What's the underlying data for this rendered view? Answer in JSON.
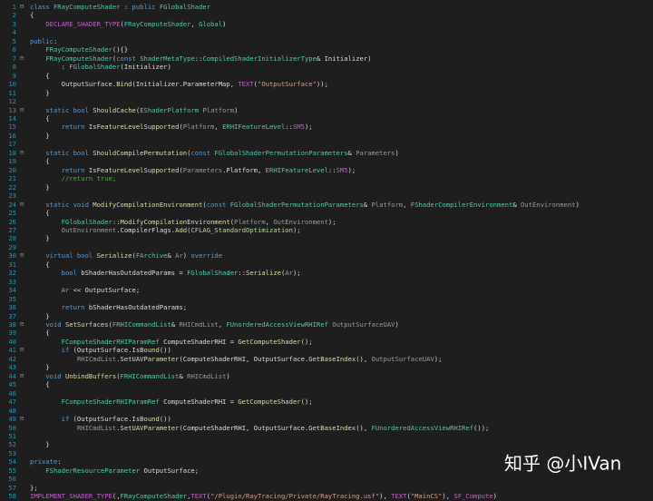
{
  "editor": {
    "lines": [
      {
        "n": "1",
        "fold": "⊟",
        "seg": [
          [
            "k",
            "class "
          ],
          [
            "ty",
            "FRayComputeShader"
          ],
          [
            "x",
            " : "
          ],
          [
            "k",
            "public "
          ],
          [
            "ty",
            "FGlobalShader"
          ]
        ]
      },
      {
        "n": "2",
        "seg": [
          [
            "x",
            "{"
          ]
        ]
      },
      {
        "n": "3",
        "seg": [
          [
            "x",
            "    "
          ],
          [
            "m",
            "DECLARE_SHADER_TYPE"
          ],
          [
            "x",
            "("
          ],
          [
            "ty",
            "FRayComputeShader"
          ],
          [
            "x",
            ", "
          ],
          [
            "ty",
            "Global"
          ],
          [
            "x",
            ")"
          ]
        ]
      },
      {
        "n": "4",
        "seg": []
      },
      {
        "n": "5",
        "seg": [
          [
            "k",
            "public"
          ],
          [
            "x",
            ":"
          ]
        ]
      },
      {
        "n": "6",
        "seg": [
          [
            "x",
            "    "
          ],
          [
            "ty",
            "FRayComputeShader"
          ],
          [
            "x",
            "(){}"
          ]
        ]
      },
      {
        "n": "7",
        "fold": "⊟",
        "seg": [
          [
            "x",
            "    "
          ],
          [
            "ty",
            "FRayComputeShader"
          ],
          [
            "x",
            "("
          ],
          [
            "k",
            "const "
          ],
          [
            "ty",
            "ShaderMetaType"
          ],
          [
            "x",
            "::"
          ],
          [
            "ty",
            "CompiledShaderInitializerType"
          ],
          [
            "x",
            "& Initializer)"
          ]
        ]
      },
      {
        "n": "8",
        "seg": [
          [
            "x",
            "        : "
          ],
          [
            "ty",
            "FGlobalShader"
          ],
          [
            "x",
            "(Initializer)"
          ]
        ]
      },
      {
        "n": "9",
        "seg": [
          [
            "x",
            "    {"
          ]
        ]
      },
      {
        "n": "10",
        "seg": [
          [
            "x",
            "        OutputSurface."
          ],
          [
            "f",
            "Bind"
          ],
          [
            "x",
            "(Initializer.ParameterMap, "
          ],
          [
            "m",
            "TEXT"
          ],
          [
            "x",
            "("
          ],
          [
            "s",
            "\"OutputSurface\""
          ],
          [
            "x",
            "));"
          ]
        ]
      },
      {
        "n": "11",
        "seg": [
          [
            "x",
            "    }"
          ]
        ]
      },
      {
        "n": "12",
        "seg": []
      },
      {
        "n": "13",
        "fold": "⊟",
        "seg": [
          [
            "x",
            "    "
          ],
          [
            "k",
            "static bool "
          ],
          [
            "f",
            "ShouldCache"
          ],
          [
            "x",
            "("
          ],
          [
            "ty",
            "EShaderPlatform"
          ],
          [
            "x",
            " "
          ],
          [
            "p",
            "Platform"
          ],
          [
            "x",
            ")"
          ]
        ]
      },
      {
        "n": "14",
        "seg": [
          [
            "x",
            "    {"
          ]
        ]
      },
      {
        "n": "15",
        "seg": [
          [
            "x",
            "        "
          ],
          [
            "k",
            "return "
          ],
          [
            "f",
            "IsFeatureLevelSupported"
          ],
          [
            "x",
            "("
          ],
          [
            "p",
            "Platform"
          ],
          [
            "x",
            ", "
          ],
          [
            "ty",
            "ERHIFeatureLevel"
          ],
          [
            "x",
            "::"
          ],
          [
            "m",
            "SM5"
          ],
          [
            "x",
            ");"
          ]
        ]
      },
      {
        "n": "16",
        "seg": [
          [
            "x",
            "    }"
          ]
        ]
      },
      {
        "n": "17",
        "seg": []
      },
      {
        "n": "18",
        "fold": "⊟",
        "seg": [
          [
            "x",
            "    "
          ],
          [
            "k",
            "static bool "
          ],
          [
            "f",
            "ShouldCompilePermutation"
          ],
          [
            "x",
            "("
          ],
          [
            "k",
            "const "
          ],
          [
            "ty",
            "FGlobalShaderPermutationParameters"
          ],
          [
            "x",
            "& "
          ],
          [
            "p",
            "Parameters"
          ],
          [
            "x",
            ")"
          ]
        ]
      },
      {
        "n": "19",
        "seg": [
          [
            "x",
            "    {"
          ]
        ]
      },
      {
        "n": "20",
        "seg": [
          [
            "x",
            "        "
          ],
          [
            "k",
            "return "
          ],
          [
            "f",
            "IsFeatureLevelSupported"
          ],
          [
            "x",
            "("
          ],
          [
            "p",
            "Parameters"
          ],
          [
            "x",
            ".Platform, "
          ],
          [
            "ty",
            "ERHIFeatureLevel"
          ],
          [
            "x",
            "::"
          ],
          [
            "m",
            "SM5"
          ],
          [
            "x",
            ");"
          ]
        ]
      },
      {
        "n": "21",
        "seg": [
          [
            "x",
            "        "
          ],
          [
            "c",
            "//return true;"
          ]
        ]
      },
      {
        "n": "22",
        "seg": [
          [
            "x",
            "    }"
          ]
        ]
      },
      {
        "n": "23",
        "seg": []
      },
      {
        "n": "24",
        "fold": "⊟",
        "seg": [
          [
            "x",
            "    "
          ],
          [
            "k",
            "static void "
          ],
          [
            "f",
            "ModifyCompilationEnvironment"
          ],
          [
            "x",
            "("
          ],
          [
            "k",
            "const "
          ],
          [
            "ty",
            "FGlobalShaderPermutationParameters"
          ],
          [
            "x",
            "& "
          ],
          [
            "p",
            "Platform"
          ],
          [
            "x",
            ", "
          ],
          [
            "ty",
            "FShaderCompilerEnvironment"
          ],
          [
            "x",
            "& "
          ],
          [
            "p",
            "OutEnvironment"
          ],
          [
            "x",
            ")"
          ]
        ]
      },
      {
        "n": "25",
        "seg": [
          [
            "x",
            "    {"
          ]
        ]
      },
      {
        "n": "26",
        "seg": [
          [
            "x",
            "        "
          ],
          [
            "ty",
            "FGlobalShader"
          ],
          [
            "x",
            "::"
          ],
          [
            "f",
            "ModifyCompilationEnvironment"
          ],
          [
            "x",
            "("
          ],
          [
            "p",
            "Platform"
          ],
          [
            "x",
            ", "
          ],
          [
            "p",
            "OutEnvironment"
          ],
          [
            "x",
            ");"
          ]
        ]
      },
      {
        "n": "27",
        "seg": [
          [
            "x",
            "        "
          ],
          [
            "p",
            "OutEnvironment"
          ],
          [
            "x",
            ".CompilerFlags."
          ],
          [
            "f",
            "Add"
          ],
          [
            "x",
            "("
          ],
          [
            "b",
            "CFLAG_StandardOptimization"
          ],
          [
            "x",
            ");"
          ]
        ]
      },
      {
        "n": "28",
        "seg": [
          [
            "x",
            "    }"
          ]
        ]
      },
      {
        "n": "29",
        "seg": []
      },
      {
        "n": "30",
        "fold": "⊟",
        "seg": [
          [
            "x",
            "    "
          ],
          [
            "k",
            "virtual bool "
          ],
          [
            "f",
            "Serialize"
          ],
          [
            "x",
            "("
          ],
          [
            "ty",
            "FArchive"
          ],
          [
            "x",
            "& "
          ],
          [
            "p",
            "Ar"
          ],
          [
            "x",
            ") "
          ],
          [
            "k",
            "override"
          ]
        ]
      },
      {
        "n": "31",
        "seg": [
          [
            "x",
            "    {"
          ]
        ]
      },
      {
        "n": "32",
        "seg": [
          [
            "x",
            "        "
          ],
          [
            "k",
            "bool "
          ],
          [
            "x",
            "bShaderHasOutdatedParams = "
          ],
          [
            "ty",
            "FGlobalShader"
          ],
          [
            "x",
            "::"
          ],
          [
            "f",
            "Serialize"
          ],
          [
            "x",
            "("
          ],
          [
            "p",
            "Ar"
          ],
          [
            "x",
            ");"
          ]
        ]
      },
      {
        "n": "33",
        "seg": []
      },
      {
        "n": "34",
        "seg": [
          [
            "x",
            "        "
          ],
          [
            "p",
            "Ar"
          ],
          [
            "x",
            " << OutputSurface;"
          ]
        ]
      },
      {
        "n": "35",
        "seg": []
      },
      {
        "n": "36",
        "seg": [
          [
            "x",
            "        "
          ],
          [
            "k",
            "return "
          ],
          [
            "x",
            "bShaderHasOutdatedParams;"
          ]
        ]
      },
      {
        "n": "37",
        "seg": [
          [
            "x",
            "    }"
          ]
        ]
      },
      {
        "n": "38",
        "fold": "⊟",
        "seg": [
          [
            "x",
            "    "
          ],
          [
            "k",
            "void "
          ],
          [
            "f",
            "SetSurfaces"
          ],
          [
            "x",
            "("
          ],
          [
            "ty",
            "FRHICommandList"
          ],
          [
            "x",
            "& "
          ],
          [
            "p",
            "RHICmdList"
          ],
          [
            "x",
            ", "
          ],
          [
            "ty",
            "FUnorderedAccessViewRHIRef"
          ],
          [
            "x",
            " "
          ],
          [
            "p",
            "OutputSurfaceUAV"
          ],
          [
            "x",
            ")"
          ]
        ]
      },
      {
        "n": "39",
        "seg": [
          [
            "x",
            "    {"
          ]
        ]
      },
      {
        "n": "40",
        "seg": [
          [
            "x",
            "        "
          ],
          [
            "ty",
            "FComputeShaderRHIParamRef"
          ],
          [
            "x",
            " ComputeShaderRHI = "
          ],
          [
            "f",
            "GetComputeShader"
          ],
          [
            "x",
            "();"
          ]
        ]
      },
      {
        "n": "41",
        "fold": "⊟",
        "seg": [
          [
            "x",
            "        "
          ],
          [
            "k",
            "if "
          ],
          [
            "x",
            "(OutputSurface."
          ],
          [
            "f",
            "IsBound"
          ],
          [
            "x",
            "())"
          ]
        ]
      },
      {
        "n": "42",
        "seg": [
          [
            "x",
            "            "
          ],
          [
            "p",
            "RHICmdList"
          ],
          [
            "x",
            "."
          ],
          [
            "f",
            "SetUAVParameter"
          ],
          [
            "x",
            "(ComputeShaderRHI, OutputSurface."
          ],
          [
            "f",
            "GetBaseIndex"
          ],
          [
            "x",
            "(), "
          ],
          [
            "p",
            "OutputSurfaceUAV"
          ],
          [
            "x",
            ");"
          ]
        ]
      },
      {
        "n": "43",
        "seg": [
          [
            "x",
            "    }"
          ]
        ]
      },
      {
        "n": "44",
        "fold": "⊟",
        "seg": [
          [
            "x",
            "    "
          ],
          [
            "k",
            "void "
          ],
          [
            "f",
            "UnbindBuffers"
          ],
          [
            "x",
            "("
          ],
          [
            "ty",
            "FRHICommandList"
          ],
          [
            "x",
            "& "
          ],
          [
            "p",
            "RHICmdList"
          ],
          [
            "x",
            ")"
          ]
        ]
      },
      {
        "n": "45",
        "seg": [
          [
            "x",
            "    {"
          ]
        ]
      },
      {
        "n": "46",
        "seg": []
      },
      {
        "n": "47",
        "seg": [
          [
            "x",
            "        "
          ],
          [
            "ty",
            "FComputeShaderRHIParamRef"
          ],
          [
            "x",
            " ComputeShaderRHI = "
          ],
          [
            "f",
            "GetComputeShader"
          ],
          [
            "x",
            "();"
          ]
        ]
      },
      {
        "n": "48",
        "seg": []
      },
      {
        "n": "49",
        "fold": "⊟",
        "seg": [
          [
            "x",
            "        "
          ],
          [
            "k",
            "if "
          ],
          [
            "x",
            "(OutputSurface."
          ],
          [
            "f",
            "IsBound"
          ],
          [
            "x",
            "())"
          ]
        ]
      },
      {
        "n": "50",
        "seg": [
          [
            "x",
            "            "
          ],
          [
            "p",
            "RHICmdList"
          ],
          [
            "x",
            "."
          ],
          [
            "f",
            "SetUAVParameter"
          ],
          [
            "x",
            "(ComputeShaderRHI, OutputSurface."
          ],
          [
            "f",
            "GetBaseIndex"
          ],
          [
            "x",
            "(), "
          ],
          [
            "ty",
            "FUnorderedAccessViewRHIRef"
          ],
          [
            "x",
            "());"
          ]
        ]
      },
      {
        "n": "51",
        "seg": []
      },
      {
        "n": "52",
        "seg": [
          [
            "x",
            "    }"
          ]
        ]
      },
      {
        "n": "53",
        "seg": []
      },
      {
        "n": "54",
        "seg": [
          [
            "k",
            "private"
          ],
          [
            "x",
            ":"
          ]
        ]
      },
      {
        "n": "55",
        "seg": [
          [
            "x",
            "    "
          ],
          [
            "ty",
            "FShaderResourceParameter"
          ],
          [
            "x",
            " OutputSurface;"
          ]
        ]
      },
      {
        "n": "56",
        "seg": []
      },
      {
        "n": "57",
        "seg": [
          [
            "x",
            "};"
          ]
        ]
      },
      {
        "n": "58",
        "seg": [
          [
            "m",
            "IMPLEMENT_SHADER_TYPE"
          ],
          [
            "x",
            "(,"
          ],
          [
            "ty",
            "FRayComputeShader"
          ],
          [
            "x",
            ","
          ],
          [
            "m",
            "TEXT"
          ],
          [
            "x",
            "("
          ],
          [
            "s",
            "\"/Plugin/RayTracing/Private/RayTracing.usf\""
          ],
          [
            "x",
            "), "
          ],
          [
            "m",
            "TEXT"
          ],
          [
            "x",
            "("
          ],
          [
            "s",
            "\"MainCS\""
          ],
          [
            "x",
            "), "
          ],
          [
            "m",
            "SF_Compute"
          ],
          [
            "x",
            ")"
          ]
        ]
      }
    ]
  },
  "watermark": {
    "brand": "知乎",
    "author": "@小IVan"
  },
  "colors": {
    "background": "#1e1e1e",
    "keyword": "#569cd6",
    "type": "#4ec9b0",
    "string": "#d69d85",
    "function": "#dcdcaa",
    "comment": "#57a64a",
    "macro": "#bd63c5",
    "parameter": "#9a9a9a",
    "line_number": "#2b91af"
  }
}
